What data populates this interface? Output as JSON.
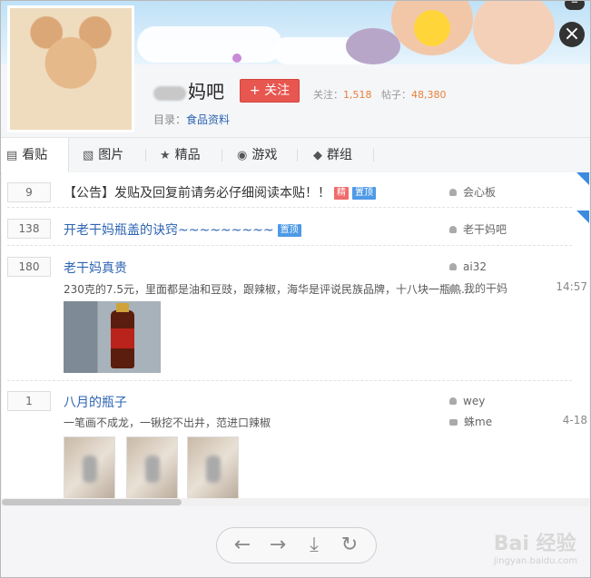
{
  "forum": {
    "name_suffix": "妈吧",
    "follow_label": "+ 关注",
    "stats": {
      "follow_label": "关注：",
      "follow_count": "1,518",
      "posts_label": "帖子：",
      "posts_count": "48,380"
    },
    "catalog_label": "目录：",
    "catalog_value": "食品资料"
  },
  "tabs": [
    {
      "label": "看贴",
      "icon": "document-icon"
    },
    {
      "label": "图片",
      "icon": "image-icon"
    },
    {
      "label": "精品",
      "icon": "star-icon"
    },
    {
      "label": "游戏",
      "icon": "gamepad-icon"
    },
    {
      "label": "群组",
      "icon": "chat-icon"
    }
  ],
  "posts": [
    {
      "replies": "9",
      "title": "【公告】发贴及回复前请务必仔细阅读本贴！！",
      "badges": [
        "精",
        "置顶"
      ],
      "author": "会心板"
    },
    {
      "replies": "138",
      "title": "开老干妈瓶盖的诀窍~~~~~~~~~",
      "badges": [
        "置顶"
      ],
      "author": "老干妈吧"
    },
    {
      "replies": "180",
      "title": "老干妈真贵",
      "excerpt": "230克的7.5元，里面都是油和豆豉，跟辣椒，海华是评说民族品牌，十八块一瓶热...",
      "author": "ai32",
      "last_reply": "我的干妈",
      "time": "14:57"
    },
    {
      "replies": "1",
      "title": "八月的瓶子",
      "excerpt": "一笔画不成龙，一锹挖不出井，范进口辣椒",
      "author": "wey",
      "last_reply": "蛛me",
      "time": "4-18"
    }
  ],
  "watermark": {
    "text": "Bai 经验",
    "sub": "jingyan.baidu.com"
  },
  "colors": {
    "accent": "#e85650",
    "link": "#2d64b3",
    "stat": "#e8803a",
    "top_corner": "#3c8bdf"
  }
}
